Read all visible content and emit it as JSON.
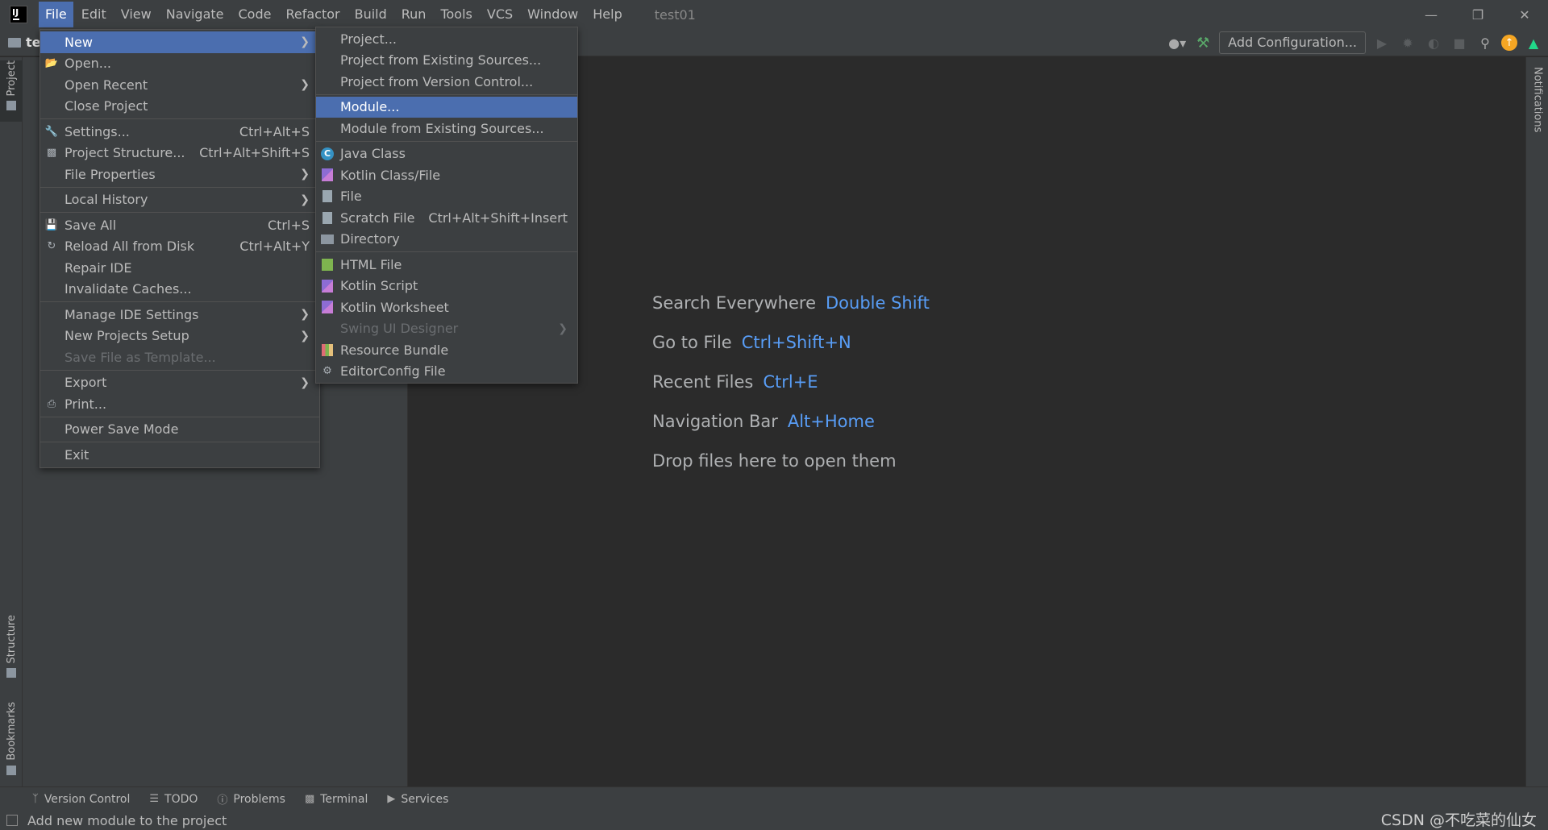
{
  "titlebar": {
    "menus": [
      "File",
      "Edit",
      "View",
      "Navigate",
      "Code",
      "Refactor",
      "Build",
      "Run",
      "Tools",
      "VCS",
      "Window",
      "Help"
    ],
    "window_title": "test01",
    "minimize": "—",
    "restore": "❐",
    "close": "✕"
  },
  "toolbar": {
    "project_name": "te",
    "add_configuration": "Add Configuration..."
  },
  "left_stripe": {
    "project": "Project",
    "structure": "Structure",
    "bookmarks": "Bookmarks"
  },
  "right_stripe": {
    "notifications": "Notifications"
  },
  "file_menu": {
    "items": [
      {
        "label": "New",
        "shortcut": "",
        "submenu": true
      },
      {
        "label": "Open...",
        "shortcut": ""
      },
      {
        "label": "Open Recent",
        "shortcut": "",
        "submenu": true
      },
      {
        "label": "Close Project",
        "shortcut": ""
      },
      {
        "label": "Settings...",
        "shortcut": "Ctrl+Alt+S"
      },
      {
        "label": "Project Structure...",
        "shortcut": "Ctrl+Alt+Shift+S"
      },
      {
        "label": "File Properties",
        "shortcut": "",
        "submenu": true
      },
      {
        "label": "Local History",
        "shortcut": "",
        "submenu": true
      },
      {
        "label": "Save All",
        "shortcut": "Ctrl+S"
      },
      {
        "label": "Reload All from Disk",
        "shortcut": "Ctrl+Alt+Y"
      },
      {
        "label": "Repair IDE",
        "shortcut": ""
      },
      {
        "label": "Invalidate Caches...",
        "shortcut": ""
      },
      {
        "label": "Manage IDE Settings",
        "shortcut": "",
        "submenu": true
      },
      {
        "label": "New Projects Setup",
        "shortcut": "",
        "submenu": true
      },
      {
        "label": "Save File as Template...",
        "shortcut": "",
        "disabled": true
      },
      {
        "label": "Export",
        "shortcut": "",
        "submenu": true
      },
      {
        "label": "Print...",
        "shortcut": ""
      },
      {
        "label": "Power Save Mode",
        "shortcut": ""
      },
      {
        "label": "Exit",
        "shortcut": ""
      }
    ]
  },
  "new_menu": {
    "items": [
      {
        "label": "Project..."
      },
      {
        "label": "Project from Existing Sources..."
      },
      {
        "label": "Project from Version Control..."
      },
      {
        "label": "Module..."
      },
      {
        "label": "Module from Existing Sources..."
      },
      {
        "label": "Java Class",
        "icon": "java-class-icon"
      },
      {
        "label": "Kotlin Class/File",
        "icon": "kotlin-icon"
      },
      {
        "label": "File",
        "icon": "file-icon"
      },
      {
        "label": "Scratch File",
        "shortcut": "Ctrl+Alt+Shift+Insert",
        "icon": "scratch-file-icon"
      },
      {
        "label": "Directory",
        "icon": "folder-icon"
      },
      {
        "label": "HTML File",
        "icon": "html-file-icon"
      },
      {
        "label": "Kotlin Script",
        "icon": "kotlin-icon"
      },
      {
        "label": "Kotlin Worksheet",
        "icon": "kotlin-icon"
      },
      {
        "label": "Swing UI Designer",
        "disabled": true
      },
      {
        "label": "Resource Bundle",
        "icon": "resource-bundle-icon"
      },
      {
        "label": "EditorConfig File",
        "icon": "gear-icon"
      }
    ]
  },
  "editor_hints": [
    {
      "label": "Search Everywhere",
      "key": "Double Shift"
    },
    {
      "label": "Go to File",
      "key": "Ctrl+Shift+N"
    },
    {
      "label": "Recent Files",
      "key": "Ctrl+E"
    },
    {
      "label": "Navigation Bar",
      "key": "Alt+Home"
    },
    {
      "label": "Drop files here to open them",
      "key": ""
    }
  ],
  "bottom_bar": {
    "tabs": [
      "Version Control",
      "TODO",
      "Problems",
      "Terminal",
      "Services"
    ]
  },
  "status_bar": {
    "message": "Add new module to the project",
    "watermark": "CSDN @不吃菜的仙女"
  },
  "colors": {
    "selection": "#4b6eaf",
    "link_key": "#589df6",
    "background": "#2b2b2b",
    "panel": "#3c3f41"
  }
}
